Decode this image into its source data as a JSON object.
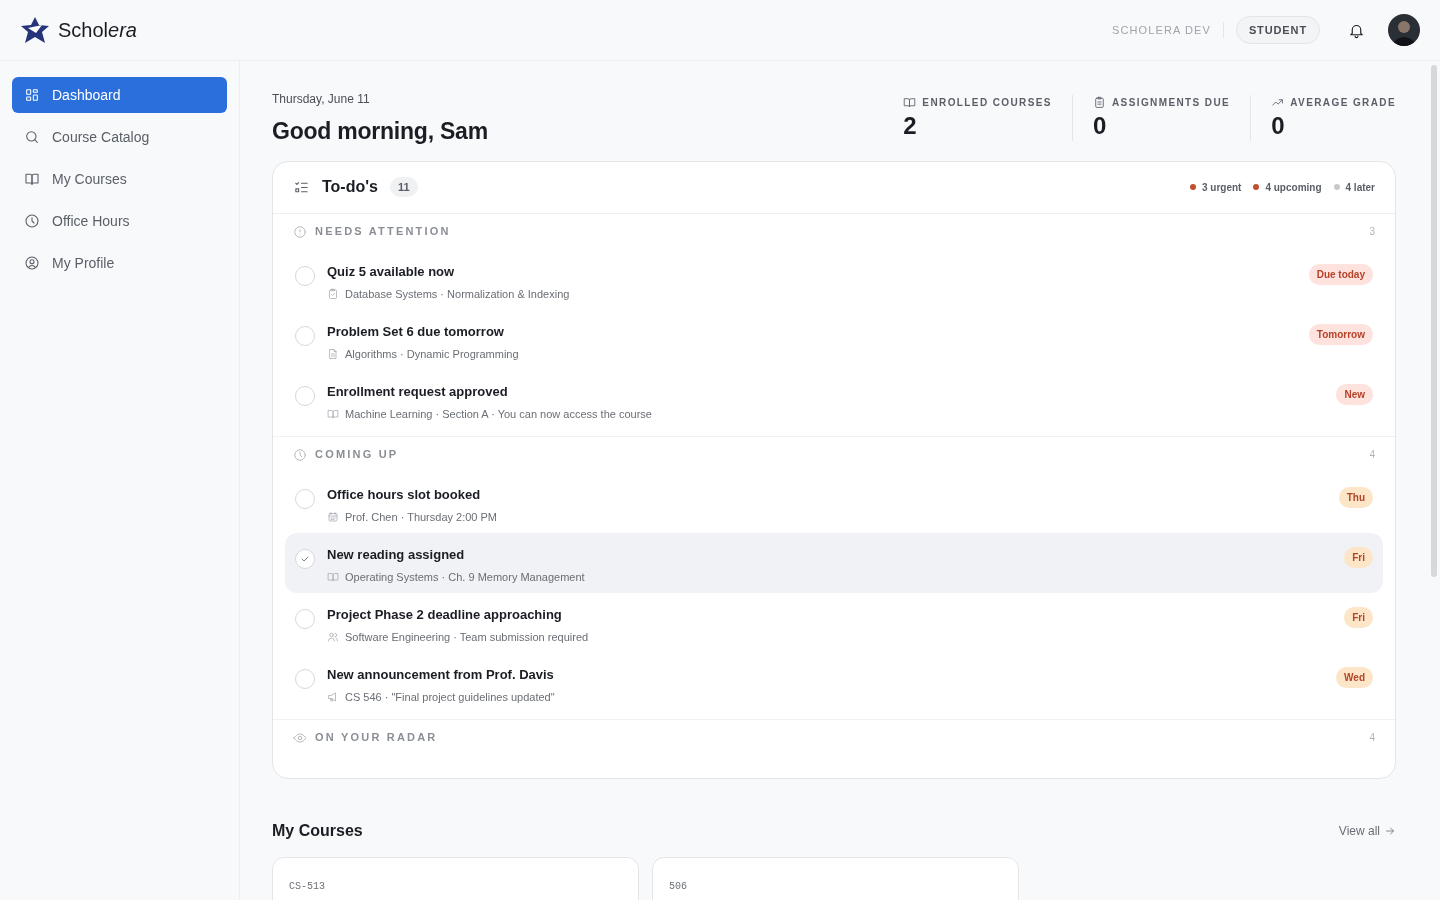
{
  "brand": {
    "name_plain": "Schol",
    "name_italic": "era"
  },
  "header": {
    "environment": "SCHOLERA DEV",
    "role": "STUDENT"
  },
  "sidebar": {
    "items": [
      {
        "label": "Dashboard",
        "selected": true
      },
      {
        "label": "Course Catalog",
        "selected": false
      },
      {
        "label": "My Courses",
        "selected": false
      },
      {
        "label": "Office Hours",
        "selected": false
      },
      {
        "label": "My Profile",
        "selected": false
      }
    ]
  },
  "greeting": {
    "date": "Thursday, June 11",
    "title": "Good morning, Sam"
  },
  "stats": [
    {
      "label": "ENROLLED COURSES",
      "value": "2"
    },
    {
      "label": "ASSIGNMENTS DUE",
      "value": "0"
    },
    {
      "label": "AVERAGE GRADE",
      "value": "0"
    }
  ],
  "todos": {
    "title": "To-do's",
    "count": "11",
    "legend": [
      {
        "label": "3 urgent",
        "color": "#c0502e"
      },
      {
        "label": "4 upcoming",
        "color": "#c0502e"
      },
      {
        "label": "4 later",
        "color": "#c8c8c8"
      }
    ],
    "sections": [
      {
        "title": "NEEDS ATTENTION",
        "count": "3",
        "items": [
          {
            "title": "Quiz 5 available now",
            "meta": "Database Systems · Normalization & Indexing",
            "badge": "Due today",
            "kind": "urgent",
            "checked": false,
            "selected": false
          },
          {
            "title": "Problem Set 6 due tomorrow",
            "meta": "Algorithms · Dynamic Programming",
            "badge": "Tomorrow",
            "kind": "urgent",
            "checked": false,
            "selected": false
          },
          {
            "title": "Enrollment request approved",
            "meta": "Machine Learning · Section A · You can now access the course",
            "badge": "New",
            "kind": "urgent",
            "checked": false,
            "selected": false
          }
        ]
      },
      {
        "title": "COMING UP",
        "count": "4",
        "items": [
          {
            "title": "Office hours slot booked",
            "meta": "Prof. Chen · Thursday 2:00 PM",
            "badge": "Thu",
            "kind": "upcoming",
            "checked": false,
            "selected": false
          },
          {
            "title": "New reading assigned",
            "meta": "Operating Systems · Ch. 9 Memory Management",
            "badge": "Fri",
            "kind": "upcoming",
            "checked": true,
            "selected": true
          },
          {
            "title": "Project Phase 2 deadline approaching",
            "meta": "Software Engineering · Team submission required",
            "badge": "Fri",
            "kind": "upcoming",
            "checked": false,
            "selected": false
          },
          {
            "title": "New announcement from Prof. Davis",
            "meta": "CS 546 · \"Final project guidelines updated\"",
            "badge": "Wed",
            "kind": "upcoming",
            "checked": false,
            "selected": false
          }
        ]
      },
      {
        "title": "ON YOUR RADAR",
        "count": "4"
      }
    ]
  },
  "courses": {
    "title": "My Courses",
    "view_all": "View all",
    "cards": [
      {
        "code": "CS-513"
      },
      {
        "code": "506"
      }
    ]
  }
}
